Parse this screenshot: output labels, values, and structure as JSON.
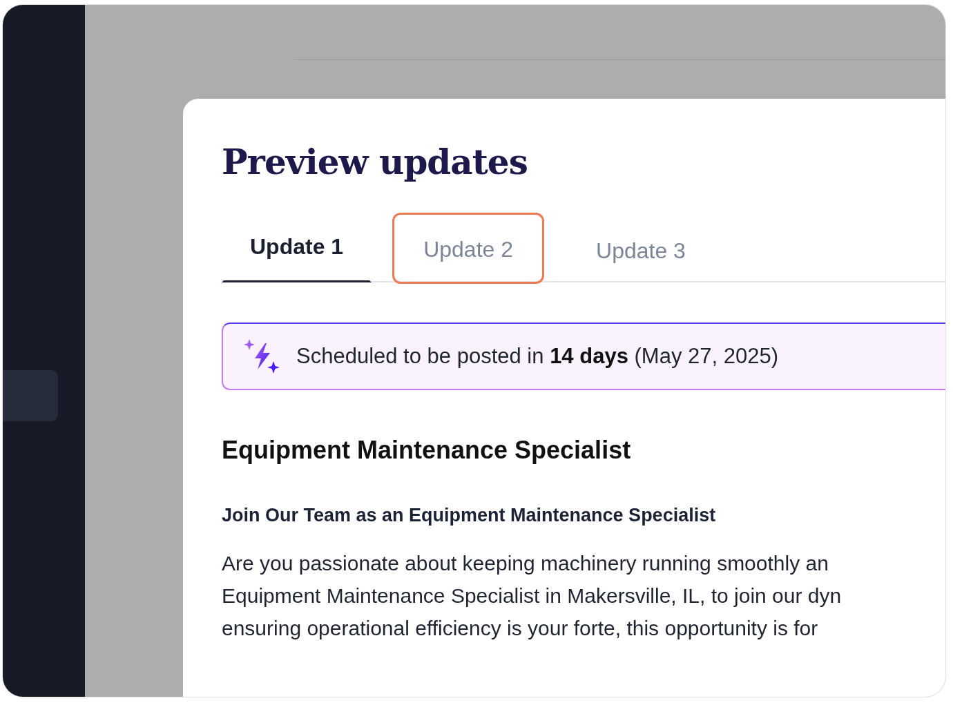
{
  "sidebar": {
    "items": [
      {
        "selected": true
      }
    ]
  },
  "modal": {
    "title": "Preview updates",
    "tabs": [
      {
        "label": "Update 1",
        "selected": true,
        "highlighted": false
      },
      {
        "label": "Update 2",
        "selected": false,
        "highlighted": true
      },
      {
        "label": "Update 3",
        "selected": false,
        "highlighted": false
      }
    ],
    "banner": "Scheduled to be posted in **14 days** (May 27, 2025)",
    "job_title": "Equipment Maintenance Specialist",
    "subheading": "Join Our Team as an Equipment Maintenance Specialist",
    "body_lines": [
      "Are you passionate about keeping machinery running smoothly an",
      "Equipment Maintenance Specialist in Makersville, IL, to join our dyn",
      "ensuring operational efficiency is your forte, this opportunity is for"
    ]
  }
}
